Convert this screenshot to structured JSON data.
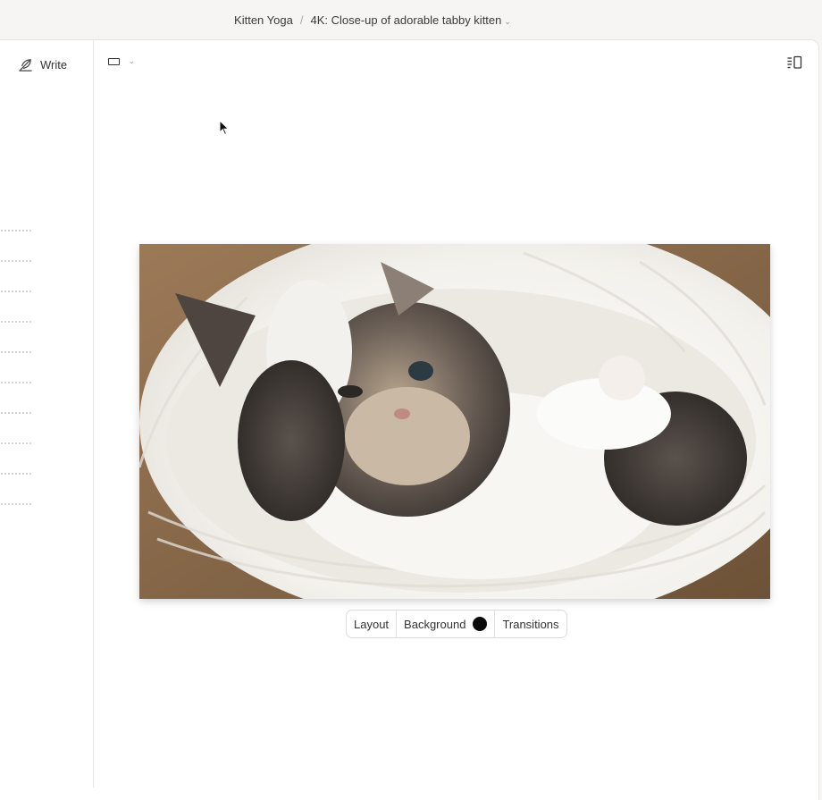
{
  "breadcrumb": {
    "project": "Kitten Yoga",
    "separator": "/",
    "page": "4K: Close-up of adorable tabby kitten"
  },
  "sidebar": {
    "write_label": "Write",
    "outline_line_count": 10
  },
  "toolbar": {
    "view_icon": "rectangle-icon",
    "panel_icon": "panel-right-icon"
  },
  "slide": {
    "image_subject": "tabby kitten lying in white knit blanket"
  },
  "slide_toolbar": {
    "layout_label": "Layout",
    "background_label": "Background",
    "background_color": "#0b0b0b",
    "transitions_label": "Transitions"
  }
}
